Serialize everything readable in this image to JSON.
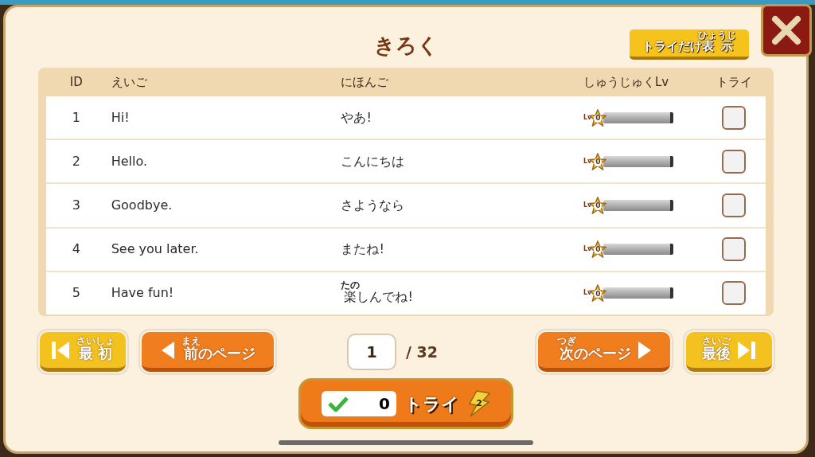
{
  "title": "きろく",
  "filter_button": {
    "label": [
      {
        "text": "トライだけ"
      },
      {
        "text": "表示",
        "ruby": "ひょうじ"
      }
    ]
  },
  "table": {
    "columns": [
      "ID",
      "えいご",
      "にほんご",
      "しゅうじゅくLv",
      "トライ"
    ],
    "rows": [
      {
        "id": "1",
        "english": "Hi!",
        "japanese": [
          {
            "text": "やあ!"
          }
        ],
        "level_label": "Lv",
        "level_value": "0",
        "level": 0,
        "checked": false
      },
      {
        "id": "2",
        "english": "Hello.",
        "japanese": [
          {
            "text": "こんにちは"
          }
        ],
        "level_label": "Lv",
        "level_value": "0",
        "level": 0,
        "checked": false
      },
      {
        "id": "3",
        "english": "Goodbye.",
        "japanese": [
          {
            "text": "さようなら"
          }
        ],
        "level_label": "Lv",
        "level_value": "0",
        "level": 0,
        "checked": false
      },
      {
        "id": "4",
        "english": "See you later.",
        "japanese": [
          {
            "text": "またね!"
          }
        ],
        "level_label": "Lv",
        "level_value": "0",
        "level": 0,
        "checked": false
      },
      {
        "id": "5",
        "english": "Have fun!",
        "japanese": [
          {
            "text": "楽",
            "ruby": "たの"
          },
          {
            "text": "しんでね!"
          }
        ],
        "level_label": "Lv",
        "level_value": "0",
        "level": 0,
        "checked": false
      }
    ]
  },
  "pagination": {
    "buttons": [
      {
        "kind": "first",
        "label": [
          {
            "text": "最初",
            "ruby": "さいしょ"
          }
        ]
      },
      {
        "kind": "prev",
        "label": [
          {
            "text": "前",
            "ruby": "まえ"
          },
          {
            "text": "のページ"
          }
        ]
      },
      {
        "kind": "next",
        "label": [
          {
            "text": "次",
            "ruby": "つぎ"
          },
          {
            "text": "のページ"
          }
        ]
      },
      {
        "kind": "last",
        "label": [
          {
            "text": "最後",
            "ruby": "さいご"
          }
        ]
      }
    ],
    "page": "1",
    "total": "/ 32"
  },
  "try_button": {
    "count": "0",
    "label": "トライ",
    "badge": "2"
  }
}
